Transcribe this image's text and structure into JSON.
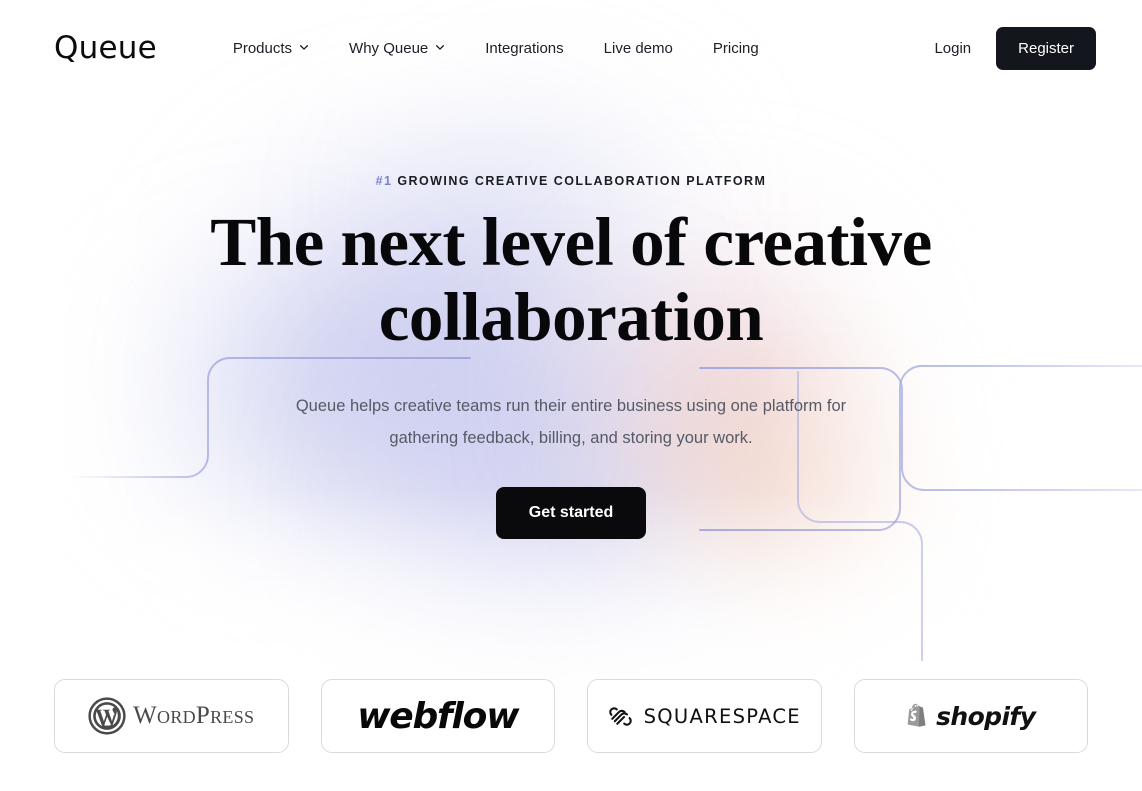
{
  "header": {
    "logo": "Queue",
    "nav": [
      {
        "label": "Products",
        "has_chevron": true,
        "icon": "chevron-down-icon"
      },
      {
        "label": "Why Queue",
        "has_chevron": true,
        "icon": "chevron-down-icon"
      },
      {
        "label": "Integrations",
        "has_chevron": false,
        "icon": ""
      },
      {
        "label": "Live demo",
        "has_chevron": false,
        "icon": ""
      },
      {
        "label": "Pricing",
        "has_chevron": false,
        "icon": ""
      }
    ],
    "login_label": "Login",
    "register_label": "Register"
  },
  "hero": {
    "eyebrow_badge": "#1",
    "eyebrow_text": "GROWING CREATIVE COLLABORATION PLATFORM",
    "headline_line1": "The next level of creative",
    "headline_line2": "collaboration",
    "subtext_line1": "Queue helps creative teams run their entire business using one platform for",
    "subtext_line2": "gathering feedback, billing, and storing your work.",
    "cta_label": "Get started"
  },
  "logos": [
    {
      "name": "WordPress",
      "text": "WordPress",
      "icon": "wordpress-logo-icon"
    },
    {
      "name": "Webflow",
      "text": "webflow",
      "icon": "webflow-logo-icon"
    },
    {
      "name": "Squarespace",
      "text": "SQUARESPACE",
      "icon": "squarespace-logo-icon"
    },
    {
      "name": "Shopify",
      "text": "shopify",
      "icon": "shopify-bag-icon"
    }
  ],
  "colors": {
    "accent_purple": "#7b7ed6",
    "button_dark": "#0a0a0c",
    "register_dark": "#14161d",
    "text_primary": "#08080b",
    "text_muted": "#555a66",
    "line_decor": "#9ea4de",
    "card_border": "#d9dae0"
  }
}
